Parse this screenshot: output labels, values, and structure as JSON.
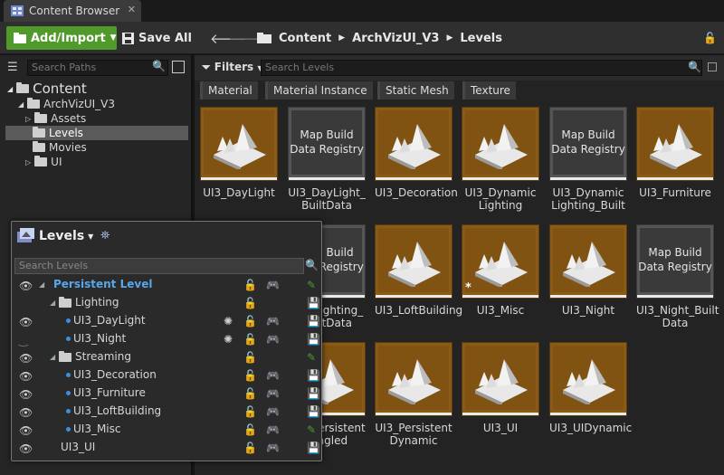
{
  "tab": {
    "title": "Content Browser"
  },
  "toolbar": {
    "add_import": "Add/Import",
    "save_all": "Save All",
    "breadcrumbs": [
      "Content",
      "ArchVizUI_V3",
      "Levels"
    ]
  },
  "sidebar": {
    "search_placeholder": "Search Paths",
    "tree": [
      {
        "label": "Content"
      },
      {
        "label": "ArchVizUI_V3"
      },
      {
        "label": "Assets"
      },
      {
        "label": "Levels"
      },
      {
        "label": "Movies"
      },
      {
        "label": "UI"
      }
    ]
  },
  "content": {
    "filters_label": "Filters",
    "search_placeholder": "Search Levels",
    "filter_chips": [
      "Material",
      "Material Instance",
      "Static Mesh",
      "Texture"
    ],
    "map_build_text": "Map Build Data Registry",
    "assets": [
      "UI3_DayLight",
      "UI3_DayLight_ BuiltData",
      "UI3_Decoration",
      "UI3_Dynamic Lighting",
      "UI3_Dynamic Lighting_Built Data",
      "UI3_Furniture",
      "UI3_Lighting_ BuiltData",
      "UI3_LoftBuilding",
      "UI3_Misc",
      "UI3_Night",
      "UI3_Night_Built Data",
      "UI3_Persistent Tangled",
      "UI3_Persistent Dynamic",
      "UI3_UI",
      "UI3_UIDynamic"
    ]
  },
  "levels_panel": {
    "title": "Levels",
    "search_placeholder": "Search Levels",
    "rows": [
      {
        "label": "Persistent Level"
      },
      {
        "label": "Lighting"
      },
      {
        "label": "UI3_DayLight"
      },
      {
        "label": "UI3_Night"
      },
      {
        "label": "Streaming"
      },
      {
        "label": "UI3_Decoration"
      },
      {
        "label": "UI3_Furniture"
      },
      {
        "label": "UI3_LoftBuilding"
      },
      {
        "label": "UI3_Misc"
      },
      {
        "label": "UI3_UI"
      }
    ]
  },
  "colors": {
    "accent_green": "#4f9a2a",
    "level_thumb": "#8a5a17",
    "persistent_level": "#57a7ea",
    "dot_blue": "#3b8fe0"
  }
}
